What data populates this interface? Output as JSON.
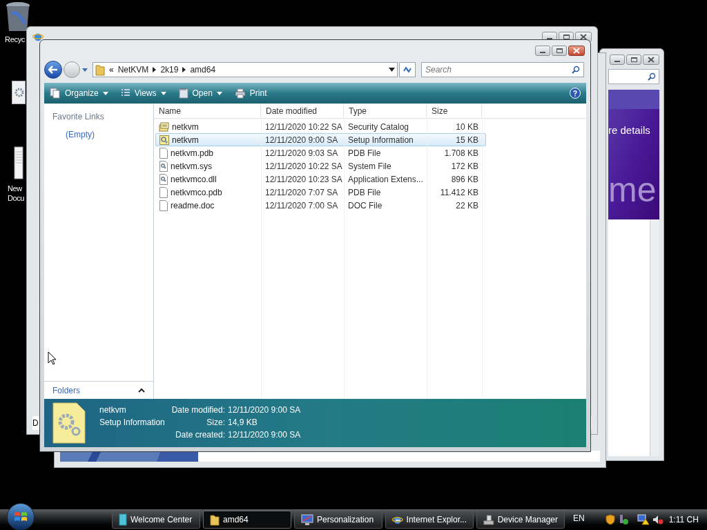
{
  "desktop_icons": [
    {
      "label": "Recyc",
      "kind": "bin"
    },
    {
      "label": "New Docu",
      "kind": "document"
    }
  ],
  "background_windows": {
    "welcome": {
      "texts": [
        "re details",
        "me"
      ]
    },
    "left": {
      "text": "D"
    }
  },
  "explorer": {
    "address": {
      "overflow": "«",
      "crumbs": [
        "NetKVM",
        "2k19",
        "amd64"
      ]
    },
    "search": {
      "placeholder": "Search"
    },
    "toolbar": [
      {
        "label": "Organize",
        "kind": "organize",
        "menu": true
      },
      {
        "label": "Views",
        "kind": "views",
        "menu": true
      },
      {
        "label": "Open",
        "kind": "open",
        "menu": true
      },
      {
        "label": "Print",
        "kind": "print",
        "menu": false
      }
    ],
    "nav": {
      "title": "Favorite Links",
      "items": [
        "(Empty)"
      ],
      "folders": "Folders"
    },
    "columns": [
      "Name",
      "Date modified",
      "Type",
      "Size"
    ],
    "rows": [
      {
        "name": "netkvm",
        "date": "12/11/2020 10:22 SA",
        "type": "Security Catalog",
        "size": "10 KB",
        "kind": "catalog",
        "selected": false
      },
      {
        "name": "netkvm",
        "date": "12/11/2020 9:00 SA",
        "type": "Setup Information",
        "size": "15 KB",
        "kind": "setup",
        "selected": true
      },
      {
        "name": "netkvm.pdb",
        "date": "12/11/2020 9:03 SA",
        "type": "PDB File",
        "size": "1.708 KB",
        "kind": "blank",
        "selected": false
      },
      {
        "name": "netkvm.sys",
        "date": "12/11/2020 10:22 SA",
        "type": "System File",
        "size": "172 KB",
        "kind": "system",
        "selected": false
      },
      {
        "name": "netkvmco.dll",
        "date": "12/11/2020 10:23 SA",
        "type": "Application Extens...",
        "size": "896 KB",
        "kind": "system",
        "selected": false
      },
      {
        "name": "netkvmco.pdb",
        "date": "12/11/2020 7:07 SA",
        "type": "PDB File",
        "size": "11.412 KB",
        "kind": "blank",
        "selected": false
      },
      {
        "name": "readme.doc",
        "date": "12/11/2020 7:00 SA",
        "type": "DOC File",
        "size": "22 KB",
        "kind": "blank",
        "selected": false
      }
    ],
    "details": {
      "name": "netkvm",
      "type": "Setup Information",
      "fields": [
        {
          "label": "Date modified:",
          "value": "12/11/2020 9:00 SA"
        },
        {
          "label": "Size:",
          "value": "14,9 KB"
        },
        {
          "label": "Date created:",
          "value": "12/11/2020 9:00 SA"
        }
      ]
    }
  },
  "taskbar": {
    "buttons": [
      {
        "label": "Welcome Center",
        "kind": "welcome",
        "selected": false
      },
      {
        "label": "amd64",
        "kind": "folder",
        "selected": true
      },
      {
        "label": "Personalization",
        "kind": "monitor",
        "selected": false
      },
      {
        "label": "Internet Explor...",
        "kind": "browser",
        "selected": false
      },
      {
        "label": "Device Manager",
        "kind": "device",
        "selected": false
      }
    ],
    "language": "EN",
    "clock": "1:11 CH"
  }
}
